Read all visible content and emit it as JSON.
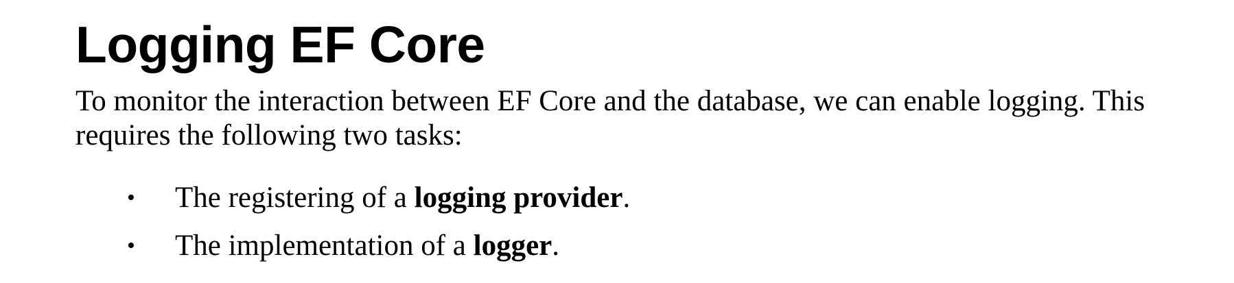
{
  "heading": "Logging EF Core",
  "paragraph": {
    "line1": "To monitor the interaction between EF Core and the database, we can enable logging. This",
    "line2": "requires the following two tasks:"
  },
  "list": {
    "bullet": "•",
    "items": [
      {
        "prefix": "The registering of a ",
        "bold": "logging provider",
        "suffix": "."
      },
      {
        "prefix": "The implementation of a ",
        "bold": "logger",
        "suffix": "."
      }
    ]
  }
}
